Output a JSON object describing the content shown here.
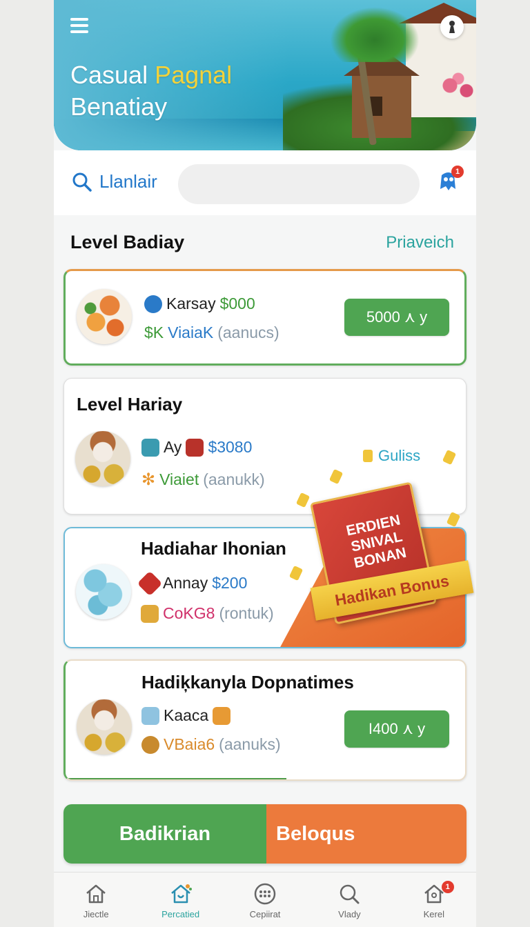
{
  "hero": {
    "title_line1_a": "Casual",
    "title_line1_b": "Pagnal",
    "title_line2": "Benatiay"
  },
  "search": {
    "label": "Llanlair",
    "placeholder": ""
  },
  "notifications": {
    "badge": "1"
  },
  "section": {
    "title": "Level Badiay",
    "link": "Priaveich"
  },
  "cards": [
    {
      "name": "Karsay",
      "amount": "$000",
      "sub_prefix": "$K",
      "sub_name": "ViaiaK",
      "sub_note": "(aanucs)",
      "button": "5000 ⋏ y"
    },
    {
      "heading": "Level Hariay",
      "name": "Ay",
      "amount": "$3080",
      "sub_name": "Viaiet",
      "sub_note": "(aanukk)"
    },
    {
      "heading": "Hadiahar Ihonian",
      "name": "Annay",
      "amount": "$200",
      "sub_name": "CoKG8",
      "sub_note": "(rontuk)"
    },
    {
      "heading": "Hadiķkanyla Dopnatimes",
      "name": "Kaaca",
      "sub_name": "VBaia6",
      "sub_note": "(aanuks)",
      "button": "I400 ⋏ y"
    }
  ],
  "promo": {
    "bonus_label": "Guliss",
    "book_lines": [
      "ERDIEN",
      "SNIVAL",
      "BONAN"
    ],
    "ribbon": "Hadikan Bonus"
  },
  "cta": {
    "left": "Badikrian",
    "right": "Beloqus"
  },
  "nav": [
    {
      "label": "Jiectle",
      "icon": "home-icon"
    },
    {
      "label": "Percatied",
      "icon": "house-heart-icon",
      "active": true
    },
    {
      "label": "Cepiirat",
      "icon": "grid-dots-icon"
    },
    {
      "label": "Vlady",
      "icon": "search-icon"
    },
    {
      "label": "Kerel",
      "icon": "profile-house-icon",
      "badge": "1"
    }
  ],
  "colors": {
    "accent_green": "#4fa552",
    "accent_orange": "#ec7a3c",
    "link_teal": "#2aa39e",
    "amount_blue": "#2a7ac8"
  }
}
